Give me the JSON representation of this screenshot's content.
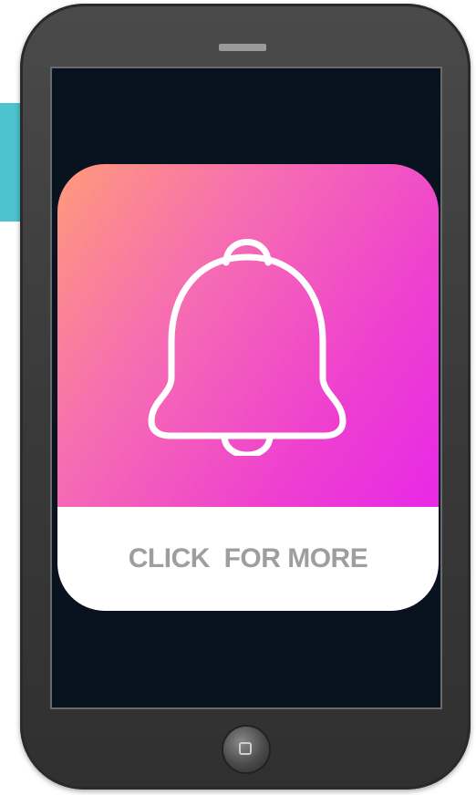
{
  "cta": {
    "label": "CLICK  FOR MORE"
  },
  "icons": {
    "notification": "bell-icon",
    "home": "home-square-icon"
  },
  "colors": {
    "accent": "#4cc3cf",
    "gradient_start": "#ff9a7a",
    "gradient_end": "#e51ff0",
    "screen_bg": "#08131f",
    "cta_text": "#9e9e9e"
  }
}
